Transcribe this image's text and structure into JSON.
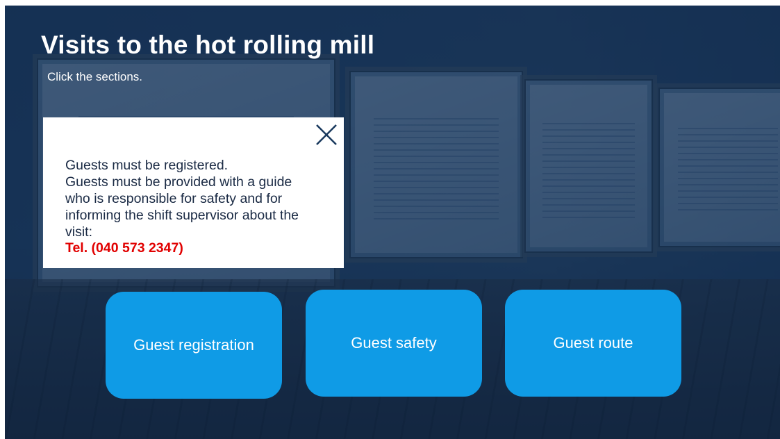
{
  "page": {
    "title": "Visits to the hot rolling mill",
    "subtitle": "Click the sections."
  },
  "popup": {
    "lines": [
      "Guests must be registered.",
      "Guests must be provided with a guide",
      "who is responsible for safety and for",
      "informing the shift supervisor about the",
      "visit:"
    ],
    "phone": "Tel. (040 573 2347)",
    "close_icon": "close-icon"
  },
  "buttons": [
    {
      "label": "Guest registration"
    },
    {
      "label": "Guest safety"
    },
    {
      "label": "Guest route"
    }
  ],
  "colors": {
    "button_blue": "#0f9be6",
    "phone_red": "#e10000",
    "overlay_navy": "#1c3a5c"
  }
}
